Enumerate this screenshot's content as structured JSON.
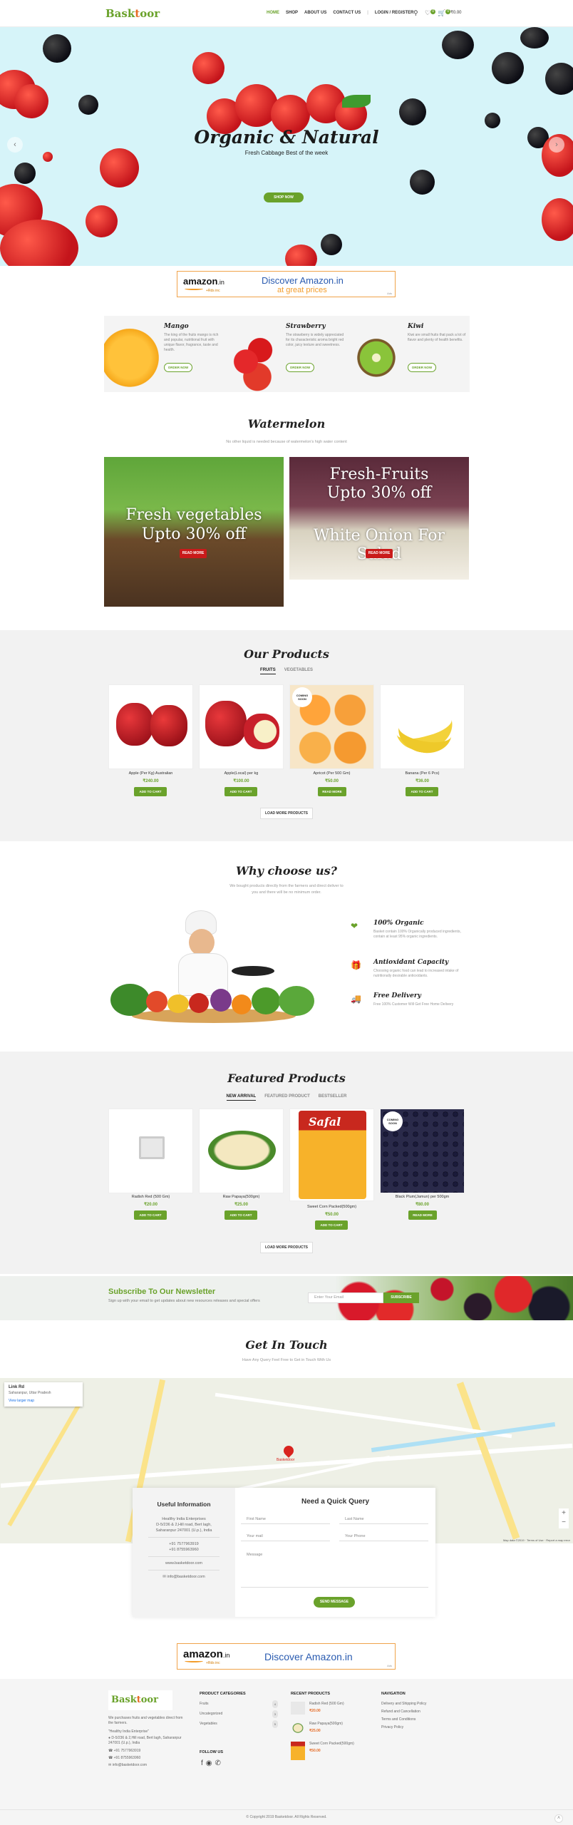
{
  "header": {
    "logo_a": "Bask",
    "logo_b": "t",
    "logo_c": "oor",
    "nav": [
      "HOME",
      "SHOP",
      "ABOUT US",
      "CONTACT US"
    ],
    "login": "LOGIN / REGISTER",
    "wishlist_count": "0",
    "cart_count": "0",
    "cart_total": "₹0.00"
  },
  "hero": {
    "title": "Organic & Natural",
    "subtitle": "Fresh Cabbage Best of the week",
    "button": "SHOP NOW"
  },
  "ad1": {
    "logo": "amazon",
    "tld": ".in",
    "fee": "+Rds inc",
    "headline": "Discover Amazon.in",
    "tagline": "at great prices",
    "tag": "Ads"
  },
  "fruits": [
    {
      "title": "Mango",
      "desc": "The king of the fruits mango is rich and popular, nutritional fruit with unique flavor, fragrance, taste and health.",
      "button": "ORDER NOW"
    },
    {
      "title": "Strawberry",
      "desc": "The strawberry is widely appreciated for its characteristic aroma bright red color, juicy texture and sweetness.",
      "button": "ORDER NOW"
    },
    {
      "title": "Kiwi",
      "desc": "Kiwi are small fruits that pack a lot of flavor and plenty of health benefits.",
      "button": "ORDER NOW"
    }
  ],
  "watermelon": {
    "title": "Watermelon",
    "subtitle": "No other liquid is needed because of watermelon's high water content"
  },
  "promo1": {
    "line1": "Fresh vegetables",
    "line2": "Upto 30% off",
    "button": "READ MORE"
  },
  "promo2": {
    "line1": "Fresh-Fruits",
    "line2": "Upto 30% off",
    "line3": "White Onion For Salad",
    "button": "READ MORE"
  },
  "products": {
    "title": "Our Products",
    "tabs": [
      "FRUITS",
      "VEGETABLES"
    ],
    "load_more": "LOAD MORE PRODUCTS",
    "coming_soon": "COMING SOON",
    "items": [
      {
        "name": "Apple (Per Kg) Australian",
        "price": "₹240.00",
        "button": "ADD TO CART"
      },
      {
        "name": "Apple(Local) per kg",
        "price": "₹100.00",
        "button": "ADD TO CART"
      },
      {
        "name": "Apricot (Per 500 Gm)",
        "price": "₹50.00",
        "button": "READ MORE"
      },
      {
        "name": "Banana (Per 6 Pcs)",
        "price": "₹36.00",
        "button": "ADD TO CART"
      }
    ]
  },
  "why": {
    "title": "Why choose us?",
    "subtitle_1": "We bought products directly from the farmers and direct deliver to",
    "subtitle_2": "you and there will be no minimum order.",
    "features": [
      {
        "title": "100% Organic",
        "desc": "Basket contain 100% Organically produced ingredients, contain at least 95% organic ingredients."
      },
      {
        "title": "Antioxidant Capacity",
        "desc": "Choosing organic food can lead to increased intake of nutritionally desirable antioxidants."
      },
      {
        "title": "Free Delivery",
        "desc": "Free 100% Customer Will Get Free Home Delivery"
      }
    ]
  },
  "featured": {
    "title": "Featured Products",
    "tabs": [
      "NEW ARRIVAL",
      "FEATURED PRODUCT",
      "BESTSELLER"
    ],
    "load_more": "LOAD MORE PRODUCTS",
    "coming_soon": "COMING SOON",
    "brand": "Safal",
    "items": [
      {
        "name": "Radish Red (500 Gm)",
        "price": "₹20.00",
        "button": "ADD TO CART"
      },
      {
        "name": "Raw Papaya(500gm)",
        "price": "₹25.00",
        "button": "ADD TO CART"
      },
      {
        "name": "Sweet Corn Packed(500gm)",
        "price": "₹50.00",
        "button": "ADD TO CART"
      },
      {
        "name": "Black Plum(Jamun) per 500gm",
        "price": "₹80.00",
        "button": "READ MORE"
      }
    ]
  },
  "newsletter": {
    "title": "Subscribe To Our Newsletter",
    "desc": "Sign up with your email to get updates about new resources releases and special offers",
    "placeholder": "Enter Your Email",
    "button": "SUBSCRIBE"
  },
  "contact": {
    "title": "Get In Touch",
    "subtitle": "Have Any Query Feel Free to Get in Touch With Us",
    "map_popup_title": "Link Rd",
    "map_popup_sub": "Saharanpur, Uttar Pradesh",
    "map_popup_link": "View larger map",
    "map_footer": "Map data ©2019 · Terms of Use · Report a map error",
    "map_marker": "Basketdoor",
    "info_title": "Useful Information",
    "info_lines": [
      "Healthy India Enterprises",
      "D-5/236 & 2,Hill road, Bert lagh,",
      "Saharanpur 247001 (U.p.), India"
    ],
    "phones": [
      "+91 7577963919",
      "+91 8755963960"
    ],
    "web": "www.basketdoor.com",
    "email": "info@basketdoor.com",
    "form_title": "Need a Quick Query",
    "first": "First Name",
    "last": "Last Name",
    "mail": "Your mail",
    "phone": "Your Phone",
    "message": "Message",
    "send": "SEND MESSAGE"
  },
  "footer": {
    "about": "We purchases fruits and vegetables direct from the farmers.",
    "tagline": "\"Healthy India Enterprise\"",
    "address": "D-5/236 & 2,Hill road, Bert lagh, Saharanpur 247001 (U.p.), India",
    "phone1": "+91 7577963919",
    "phone2": "+91 8755963960",
    "email": "info@basketdoor.com",
    "cat_title": "PRODUCT CATEGORIES",
    "cats": [
      {
        "name": "Fruits",
        "count": "4"
      },
      {
        "name": "Uncategorized",
        "count": "3"
      },
      {
        "name": "Vegetables",
        "count": "5"
      }
    ],
    "follow": "FOLLOW US",
    "recent_title": "RECENT PRODUCTS",
    "recent": [
      {
        "name": "Radish Red (500 Gm)",
        "price": "₹20.00"
      },
      {
        "name": "Raw Papaya(500gm)",
        "price": "₹25.00"
      },
      {
        "name": "Sweet Corn Packed(500gm)",
        "price": "₹50.00"
      }
    ],
    "nav_title": "NAVIGATION",
    "nav": [
      "Delivery and Shipping Policy",
      "Refund and Cancellation",
      "Terms and Conditions",
      "Privacy Policy"
    ],
    "copyright": "© Copyright 2019 Basketdoor. All Rights Reserved."
  },
  "colors": {
    "brand": "#6aa22b",
    "accent": "#e66b25",
    "hero_bg": "#d6f4f9"
  }
}
